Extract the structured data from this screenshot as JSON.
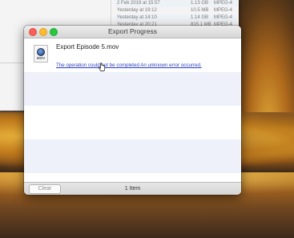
{
  "background_window": {
    "rows": [
      {
        "date": "2 Feb 2019 at 15:57",
        "size": "1.13 GB",
        "kind": "MPEG-4"
      },
      {
        "date": "Yesterday at 19:12",
        "size": "10.5 MB",
        "kind": "MPEG-4"
      },
      {
        "date": "Yesterday at 14:10",
        "size": "1.14 GB",
        "kind": "MPEG-4"
      },
      {
        "date": "Yesterday at 20:21",
        "size": "815.1 MB",
        "kind": "MPEG-4"
      }
    ]
  },
  "window": {
    "title": "Export Progress"
  },
  "export_item": {
    "icon_label": "MOV",
    "name": "Export Episode 5.mov",
    "error": "The operation could not be completed An unknown error occurred."
  },
  "bottom_bar": {
    "clear_label": "Clear",
    "item_count": "1 Item"
  },
  "colors": {
    "close": "#fc5f57",
    "minimize": "#fdbc2e",
    "zoom": "#28c840",
    "error_link": "#2a3fbf",
    "stripe": "#eef1fa"
  }
}
